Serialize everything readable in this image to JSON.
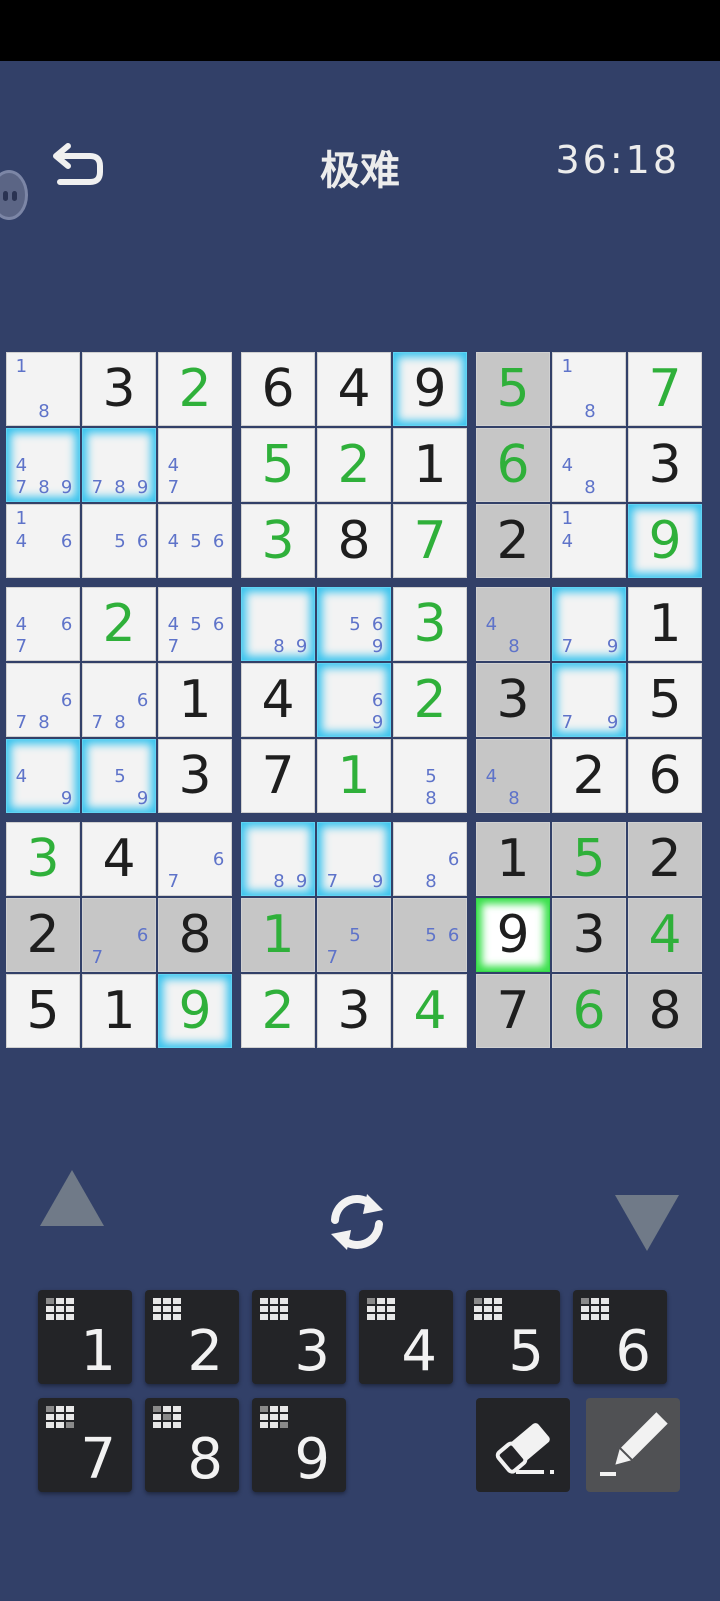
{
  "header": {
    "title": "极难",
    "timer": "36:18"
  },
  "board": {
    "rows": [
      [
        {
          "c": "18"
        },
        {
          "v": "3"
        },
        {
          "v": "2",
          "u": 1
        },
        {
          "v": "6"
        },
        {
          "v": "4"
        },
        {
          "v": "9",
          "g": 1
        },
        {
          "v": "5",
          "u": 1,
          "d": 1
        },
        {
          "c": "18"
        },
        {
          "v": "7",
          "u": 1
        }
      ],
      [
        {
          "c": "4789",
          "g": 1
        },
        {
          "c": "789",
          "g": 1
        },
        {
          "c": "47"
        },
        {
          "v": "5",
          "u": 1
        },
        {
          "v": "2",
          "u": 1
        },
        {
          "v": "1"
        },
        {
          "v": "6",
          "u": 1,
          "d": 1
        },
        {
          "c": "48"
        },
        {
          "v": "3"
        }
      ],
      [
        {
          "c": "146"
        },
        {
          "c": "56"
        },
        {
          "c": "456"
        },
        {
          "v": "3",
          "u": 1
        },
        {
          "v": "8"
        },
        {
          "v": "7",
          "u": 1
        },
        {
          "v": "2",
          "d": 1
        },
        {
          "c": "14"
        },
        {
          "v": "9",
          "u": 1,
          "g": 1
        }
      ],
      [
        {
          "c": "467"
        },
        {
          "v": "2",
          "u": 1
        },
        {
          "c": "4567"
        },
        {
          "c": "89",
          "g": 1
        },
        {
          "c": "569",
          "g": 1
        },
        {
          "v": "3",
          "u": 1
        },
        {
          "c": "48",
          "d": 1
        },
        {
          "c": "79",
          "g": 1
        },
        {
          "v": "1"
        }
      ],
      [
        {
          "c": "678"
        },
        {
          "c": "678"
        },
        {
          "v": "1"
        },
        {
          "v": "4"
        },
        {
          "c": "69",
          "g": 1
        },
        {
          "v": "2",
          "u": 1
        },
        {
          "v": "3",
          "d": 1
        },
        {
          "c": "79",
          "g": 1
        },
        {
          "v": "5"
        }
      ],
      [
        {
          "c": "49",
          "g": 1
        },
        {
          "c": "59",
          "g": 1
        },
        {
          "v": "3"
        },
        {
          "v": "7"
        },
        {
          "v": "1",
          "u": 1
        },
        {
          "c": "58"
        },
        {
          "c": "48",
          "d": 1
        },
        {
          "v": "2"
        },
        {
          "v": "6"
        }
      ],
      [
        {
          "v": "3",
          "u": 1
        },
        {
          "v": "4"
        },
        {
          "c": "67"
        },
        {
          "c": "89",
          "g": 1
        },
        {
          "c": "79",
          "g": 1
        },
        {
          "c": "68"
        },
        {
          "v": "1",
          "d": 1
        },
        {
          "v": "5",
          "u": 1,
          "d": 1
        },
        {
          "v": "2",
          "d": 1
        }
      ],
      [
        {
          "v": "2",
          "d": 1
        },
        {
          "c": "67",
          "d": 1
        },
        {
          "v": "8",
          "d": 1
        },
        {
          "v": "1",
          "u": 1,
          "d": 1
        },
        {
          "c": "57",
          "d": 1
        },
        {
          "c": "56",
          "d": 1
        },
        {
          "v": "9",
          "s": 1
        },
        {
          "v": "3",
          "d": 1
        },
        {
          "v": "4",
          "u": 1,
          "d": 1
        }
      ],
      [
        {
          "v": "5"
        },
        {
          "v": "1"
        },
        {
          "v": "9",
          "u": 1,
          "g": 1
        },
        {
          "v": "2",
          "u": 1
        },
        {
          "v": "3"
        },
        {
          "v": "4",
          "u": 1
        },
        {
          "v": "7",
          "d": 1
        },
        {
          "v": "6",
          "u": 1,
          "d": 1
        },
        {
          "v": "8",
          "d": 1
        }
      ]
    ]
  },
  "keypad": {
    "keys": [
      {
        "n": "1",
        "dots": [
          0
        ]
      },
      {
        "n": "2",
        "dots": []
      },
      {
        "n": "3",
        "dots": []
      },
      {
        "n": "4",
        "dots": [
          0
        ]
      },
      {
        "n": "5",
        "dots": [
          0
        ]
      },
      {
        "n": "6",
        "dots": [
          0
        ]
      },
      {
        "n": "7",
        "dots": [
          0,
          8
        ]
      },
      {
        "n": "8",
        "dots": [
          0,
          4
        ]
      },
      {
        "n": "9",
        "dots": [
          0,
          8
        ]
      }
    ]
  },
  "icons": {
    "back": "back-arrow-icon",
    "refresh": "refresh-icon",
    "up": "triangle-up-icon",
    "down": "triangle-down-icon",
    "eraser": "eraser-icon",
    "pencil": "pencil-icon"
  },
  "colors": {
    "background": "#324068",
    "given": "#1e1e1e",
    "user": "#2fb03a",
    "candidate": "#5e73c9",
    "highlight": "#37c3ee",
    "selected": "#38e04a"
  }
}
